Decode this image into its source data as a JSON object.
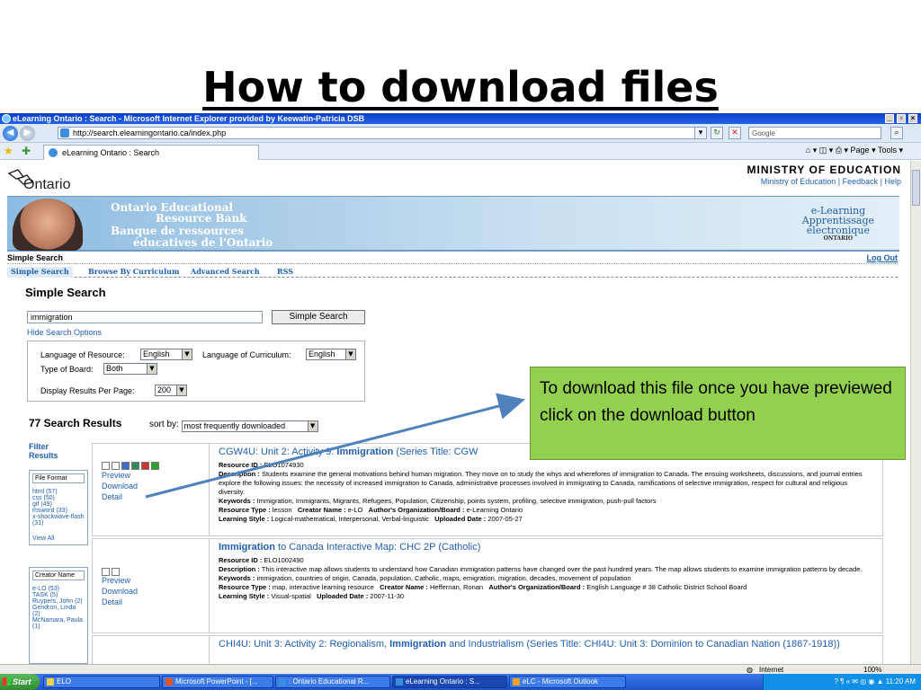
{
  "slide": {
    "title": "How to download files"
  },
  "browser": {
    "window_title": "eLearning Ontario : Search - Microsoft Internet Explorer provided by Keewatin-Patricia DSB",
    "url": "http://search.elearningontario.ca/index.php",
    "search_placeholder": "Google",
    "tab_label": "eLearning Ontario : Search",
    "tools": {
      "page": "Page",
      "tools": "Tools"
    },
    "status_zone": "Internet",
    "zoom": "100%"
  },
  "site": {
    "logo_text": "Ontario",
    "ministry": "MINISTRY OF EDUCATION",
    "links": [
      "Ministry of Education",
      "Feedback",
      "Help"
    ],
    "banner": {
      "line1": "Ontario Educational",
      "line2": "Resource Bank",
      "line3": "Banque de ressources",
      "line4": "éducatives de l'Ontario",
      "elogo1": "e-Learning",
      "elogo2": "Apprentissage",
      "elogo3": "électronique",
      "elogo4": "ONTARIO"
    },
    "crumb": "Simple Search",
    "logout": "Log Out",
    "nav": [
      "Simple Search",
      "Browse By Curriculum",
      "Advanced Search",
      "RSS"
    ]
  },
  "search": {
    "heading": "Simple Search",
    "query": "immigration",
    "button": "Simple Search",
    "hide_options": "Hide Search Options",
    "lang_resource_label": "Language of Resource:",
    "lang_resource": "English",
    "lang_curriculum_label": "Language of Curriculum:",
    "lang_curriculum": "English",
    "board_label": "Type of Board:",
    "board": "Both",
    "per_page_label": "Display Results Per Page:",
    "per_page": "200"
  },
  "results_header": {
    "count": "77 Search Results",
    "sort_label": "sort by:",
    "sort_value": "most frequently downloaded"
  },
  "filters": {
    "title": "Filter Results",
    "file_format": {
      "title": "File Format",
      "items": [
        "html (57)",
        "css (50)",
        "gif (49)",
        "msword (33)",
        "x-shockwave-flash (31)"
      ],
      "view_all": "View All"
    },
    "creator": {
      "title": "Creator Name",
      "items": [
        "e-LO (53)",
        "TASK (5)",
        "Ruypers, John (2)",
        "Gendron, Linda (2)",
        "McNamara, Paula (1)"
      ]
    }
  },
  "results": [
    {
      "actions": [
        "Preview",
        "Download",
        "Detail"
      ],
      "title_pre": "CGW4U: Unit 2: Activity 9: ",
      "title_hl": "Immigration",
      "title_post": " (Series Title: CGW",
      "resource_id": "ELO1074930",
      "description": "Students examine the general motivations behind human migration. They move on to study the whys and wherefores of immigration to Canada. The ensuing worksheets, discussions, and journal entries explore the following issues: the necessity of increased immigration to Canada, administrative processes involved in immigrating to Canada, ramifications of selective immigration, respect for cultural and religious diversity.",
      "keywords": "Immigration, Immigrants, Migrants, Refugees, Population, Citizenship, points system, profiling, selective immigration, push-pull factors",
      "resource_type": "lesson",
      "creator": "e-LO",
      "org": "e-Learning Ontario",
      "learning_style": "Logical-mathematical, Interpersonal, Verbal-linguistic",
      "uploaded": "2007-05-27"
    },
    {
      "actions": [
        "Preview",
        "Download",
        "Detail"
      ],
      "title_pre": "",
      "title_hl": "Immigration",
      "title_post": " to Canada Interactive Map: CHC 2P (Catholic)",
      "resource_id": "ELO1002490",
      "description": "This interactive map allows students to understand how Canadian immigration patterns have changed over the past hundred years. The map allows students to examine immigration patterns by decade.",
      "keywords": "immigration, countries of origin, Canada, population, Catholic, maps, emigration, migration, decades, movement of population",
      "resource_type": "map, interactive learning resource",
      "creator": "Heffernan, Ronan",
      "org": "English Language # 38 Catholic District School Board",
      "learning_style": "Visual-spatial",
      "uploaded": "2007-11-30"
    },
    {
      "title_pre": "CHI4U: Unit 3: Activity 2: Regionalism, ",
      "title_hl": "Immigration",
      "title_post": " and Industrialism (Series Title: CHI4U: Unit 3: Dominion to Canadian Nation (1867-1918))"
    }
  ],
  "labels": {
    "resource_id": "Resource ID :",
    "description": "Description :",
    "keywords": "Keywords :",
    "resource_type": "Resource Type :",
    "creator": "Creator Name :",
    "org": "Author's Organization/Board :",
    "learning_style": "Learning Style :",
    "uploaded": "Uploaded Date :"
  },
  "callout": {
    "text": "To download this file once you have previewed click on the download button"
  },
  "taskbar": {
    "start": "Start",
    "tasks": [
      "ELO",
      "Microsoft PowerPoint - [...",
      ": Ontario Educational R...",
      "eLearning Ontario : S...",
      "eLC - Microsoft Outlook"
    ],
    "clock": "11:20 AM"
  },
  "colors": {
    "accent_link": "#1f5fb0",
    "callout_bg": "#92d050",
    "arrow": "#4f81bd",
    "titlebar": "#0a3fc8"
  }
}
